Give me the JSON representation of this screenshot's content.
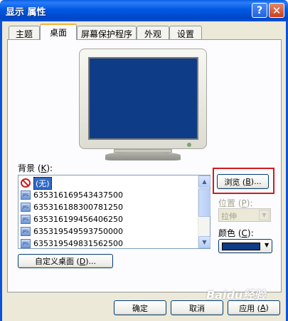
{
  "window": {
    "title": "显示 属性",
    "help_glyph": "?",
    "close_glyph": "✕"
  },
  "tabs": [
    {
      "label": "主题"
    },
    {
      "label": "桌面"
    },
    {
      "label": "屏幕保护程序"
    },
    {
      "label": "外观"
    },
    {
      "label": "设置"
    }
  ],
  "active_tab": "桌面",
  "background": {
    "label_prefix": "背景 (",
    "label_key": "K",
    "label_suffix": "):",
    "items": [
      {
        "text": "(无)",
        "icon": "no-icon",
        "selected": true
      },
      {
        "text": "635316169543437500",
        "icon": "jpg-image-icon"
      },
      {
        "text": "635316188300781250",
        "icon": "jpg-image-icon"
      },
      {
        "text": "635316199456406250",
        "icon": "jpg-image-icon"
      },
      {
        "text": "635319549593750000",
        "icon": "jpg-image-icon"
      },
      {
        "text": "635319549831562500",
        "icon": "jpg-image-icon"
      }
    ],
    "jpg_icon_text": "JPG"
  },
  "browse_button": {
    "prefix": "浏览 (",
    "key": "B",
    "suffix": ")..."
  },
  "position": {
    "label_prefix": "位置 (",
    "label_key": "P",
    "label_suffix": "):",
    "value": "拉伸"
  },
  "color": {
    "label_prefix": "颜色 (",
    "label_key": "C",
    "label_suffix": "):",
    "value": "#0e3c86"
  },
  "customize_button": {
    "prefix": "自定义桌面 (",
    "key": "D",
    "suffix": ")..."
  },
  "footer": {
    "ok_label": "确定",
    "cancel_label": "取消",
    "apply_prefix": "应用 (",
    "apply_key": "A",
    "apply_suffix": ")"
  },
  "watermark": "Baidu经验",
  "colors": {
    "screen": "#0e3c86",
    "title_bar": "#0058e0",
    "highlight": "#d21b1b",
    "selection": "#316ac5"
  }
}
